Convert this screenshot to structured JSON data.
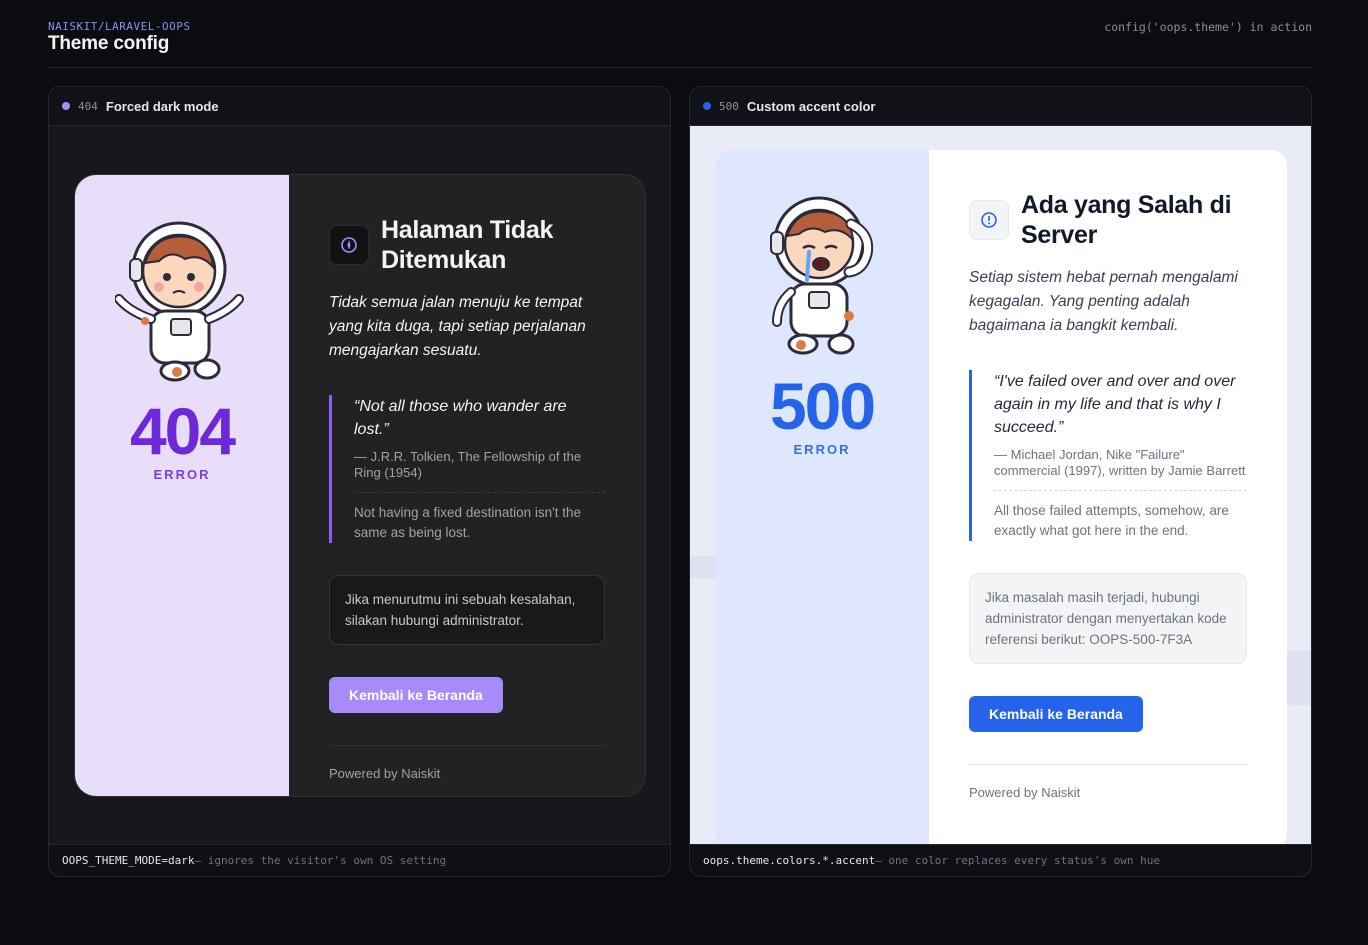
{
  "header": {
    "eyebrow": "NAISKIT/LARAVEL-OOPS",
    "title": "Theme config",
    "right": "config('oops.theme') in action"
  },
  "colors": {
    "dark_accent": "#8b5cf6",
    "light_accent": "#2563eb"
  },
  "panels": [
    {
      "dot_color": "#a78bfa",
      "code": "404",
      "label": "Forced dark mode",
      "footer_key": "OOPS_THEME_MODE=dark",
      "footer_text": " — ignores the visitor's own OS setting",
      "card": {
        "big": "404",
        "error_label": "ERROR",
        "icon": "compass-icon",
        "title": "Halaman Tidak Ditemukan",
        "lead": "Tidak semua jalan menuju ke tempat yang kita duga, tapi setiap perjalanan mengajarkan sesuatu.",
        "quote": "“Not all those who wander are lost.”",
        "quote_source": "— J.R.R. Tolkien, The Fellowship of the Ring (1954)",
        "quote_note": "Not having a fixed destination isn't the same as being lost.",
        "note": "Jika menurutmu ini sebuah kesalahan, silakan hubungi administrator.",
        "button": "Kembali ke Beranda",
        "powered": "Powered by Naiskit"
      }
    },
    {
      "dot_color": "#2563eb",
      "code": "500",
      "label": "Custom accent color",
      "footer_key": "oops.theme.colors.*.accent",
      "footer_text": " — one color replaces every status's own hue",
      "card": {
        "big": "500",
        "error_label": "ERROR",
        "icon": "alert-circle-icon",
        "title": "Ada yang Salah di Server",
        "lead": "Setiap sistem hebat pernah mengalami kegagalan. Yang penting adalah bagaimana ia bangkit kembali.",
        "quote": "“I've failed over and over and over again in my life and that is why I succeed.”",
        "quote_source": "— Michael Jordan, Nike \"Failure\" commercial (1997), written by Jamie Barrett",
        "quote_note": "All those failed attempts, somehow, are exactly what got here in the end.",
        "note": "Jika masalah masih terjadi, hubungi administrator dengan menyertakan kode referensi berikut: OOPS-500-7F3A",
        "button": "Kembali ke Beranda",
        "powered": "Powered by Naiskit"
      }
    }
  ]
}
